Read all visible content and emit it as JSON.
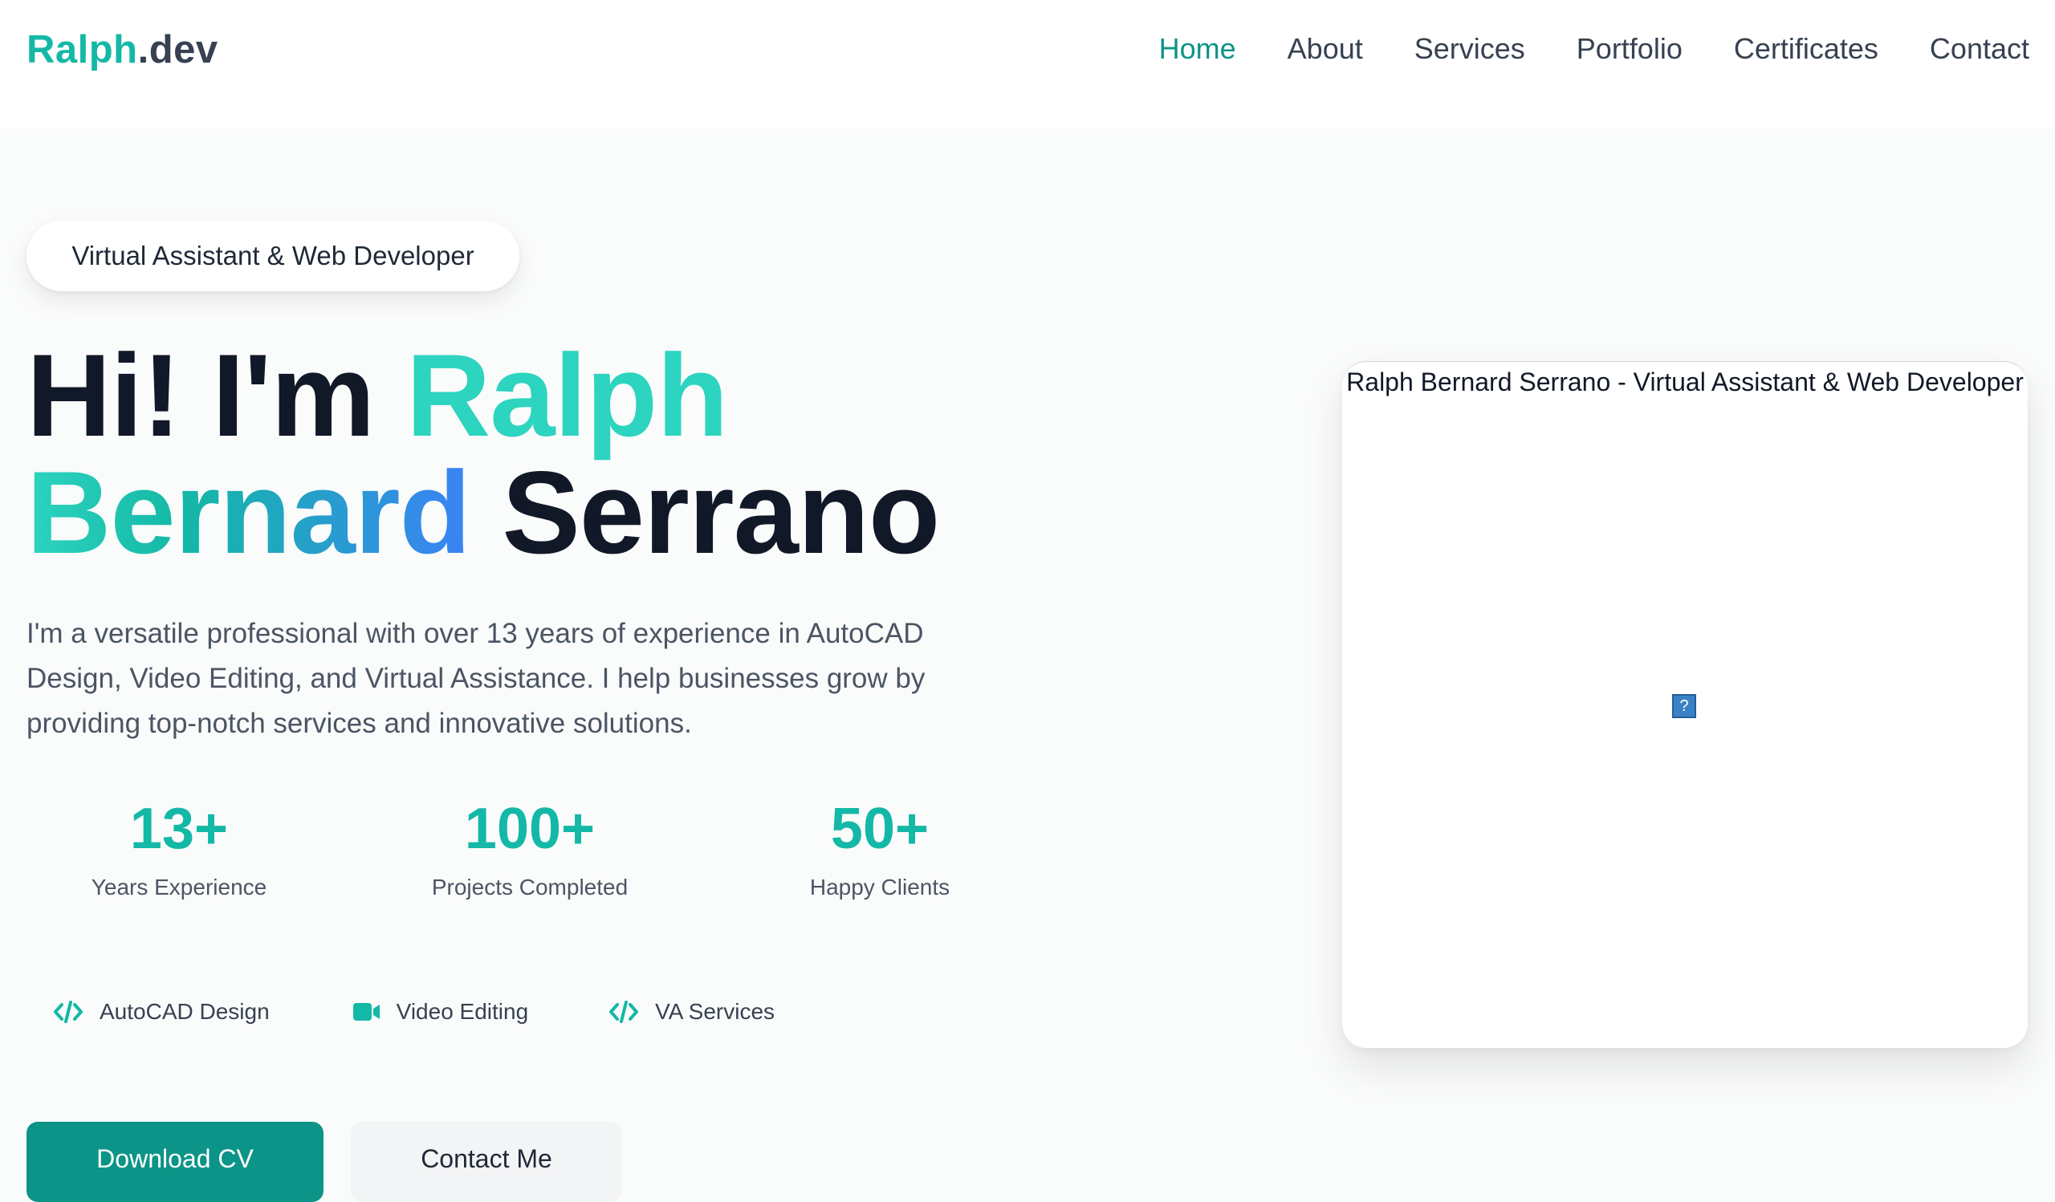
{
  "header": {
    "logo_brand": "Ralph",
    "logo_tld": ".dev",
    "nav": [
      {
        "label": "Home",
        "active": true
      },
      {
        "label": "About",
        "active": false
      },
      {
        "label": "Services",
        "active": false
      },
      {
        "label": "Portfolio",
        "active": false
      },
      {
        "label": "Certificates",
        "active": false
      },
      {
        "label": "Contact",
        "active": false
      }
    ]
  },
  "hero": {
    "badge": "Virtual Assistant & Web Developer",
    "heading_hi": "Hi! I'm ",
    "heading_ralph": "Ralph",
    "heading_bernard": "Bernard",
    "heading_serrano": " Serrano",
    "intro": "I'm a versatile professional with over 13 years of experience in AutoCAD Design, Video Editing, and Virtual Assistance. I help businesses grow by providing top-notch services and innovative solutions.",
    "stats": [
      {
        "value": "13+",
        "label": "Years Experience"
      },
      {
        "value": "100+",
        "label": "Projects Completed"
      },
      {
        "value": "50+",
        "label": "Happy Clients"
      }
    ],
    "skills": [
      {
        "label": "AutoCAD Design",
        "icon": "code-icon"
      },
      {
        "label": "Video Editing",
        "icon": "video-icon"
      },
      {
        "label": "VA Services",
        "icon": "code-icon"
      }
    ],
    "primary_button": "Download CV",
    "secondary_button": "Contact Me"
  },
  "profile_image": {
    "alt": "Ralph Bernard Serrano - Virtual Assistant & Web Developer",
    "broken_icon": "?"
  },
  "colors": {
    "accent": "#14b8a6",
    "accent_dark": "#0d9488",
    "gradient_end": "#3b82f6",
    "text_dark": "#111827"
  }
}
